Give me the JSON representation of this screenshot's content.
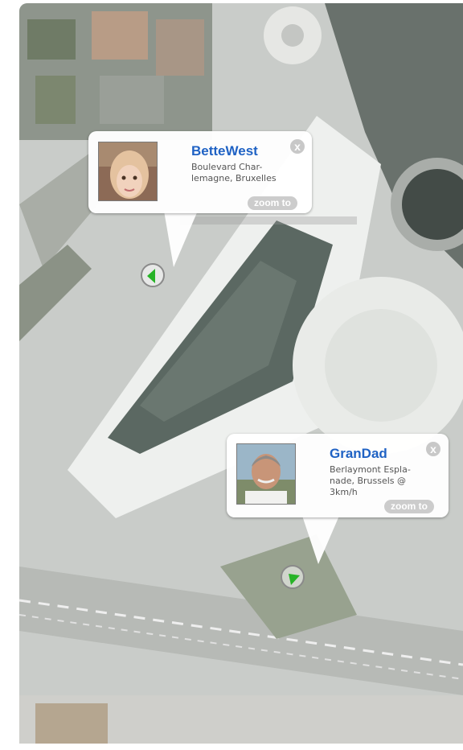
{
  "map": {
    "colors": {
      "terrain": "#c9ccc9",
      "road": "#dadbd8",
      "water": "#5a6760",
      "building": "#eceeec",
      "vegetation": "#7f8d72"
    }
  },
  "people": [
    {
      "name": "BetteWest",
      "address": "Boulevard Char-\nlemagne,  Bruxelles",
      "zoom_label": "zoom to",
      "close_label": "x",
      "photo_icon": "child-portrait",
      "marker_color": "#27b327"
    },
    {
      "name": "GranDad",
      "address": "Berlaymont Espla-\nnade, Brussels @\n3km/h",
      "zoom_label": "zoom to",
      "close_label": "x",
      "photo_icon": "man-portrait",
      "marker_color": "#27b327"
    }
  ]
}
